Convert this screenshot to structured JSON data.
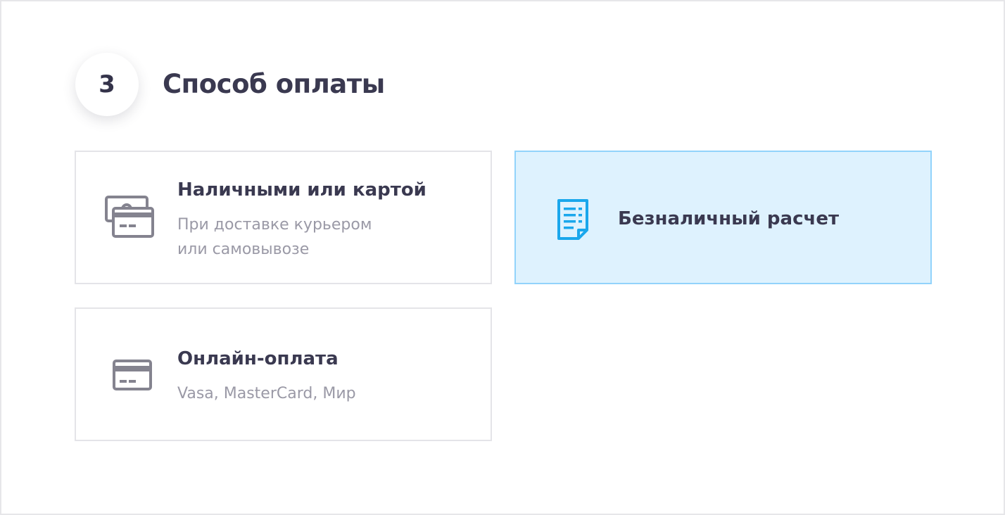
{
  "step": {
    "number": "3",
    "title": "Способ оплаты"
  },
  "options": [
    {
      "title": "Наличными или картой",
      "subtitle_lines": [
        "При доставке курьером",
        "или самовывозе"
      ],
      "icon": "cash-and-card-icon",
      "selected": false
    },
    {
      "title": "Безналичный расчет",
      "subtitle_lines": [],
      "icon": "invoice-document-icon",
      "selected": true
    },
    {
      "title": "Онлайн-оплата",
      "subtitle_lines": [
        "Vasa, MasterCard, Мир"
      ],
      "icon": "credit-card-icon",
      "selected": false
    }
  ],
  "colors": {
    "accent": "#1aa7ec",
    "selected_bg": "#def2fe",
    "selected_border": "#92d3fb",
    "title_text": "#3a3950",
    "muted_text": "#9a99a6",
    "icon_gray": "#84838f"
  }
}
